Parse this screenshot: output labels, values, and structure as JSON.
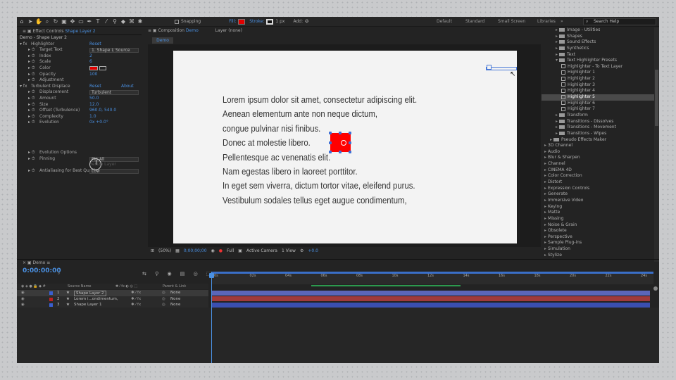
{
  "toolbar": {
    "snapping": "Snapping",
    "fill_label": "Fill:",
    "stroke_label": "Stroke:",
    "stroke_size": "1 px",
    "add_label": "Add:",
    "workspaces": [
      "Default",
      "Standard",
      "Small Screen",
      "Libraries"
    ],
    "search_help": "Search Help",
    "accent": "#4a90e2"
  },
  "effect_controls": {
    "tab_label": "Effect Controls",
    "tab_layer": "Shape Layer 2",
    "subtitle": "Demo - Shape Layer 2",
    "rows": [
      {
        "label": "Highlighter",
        "value": "Reset",
        "indent": 0,
        "type": "fx"
      },
      {
        "label": "Target Text",
        "value": "1. Shape L",
        "value2": "Source",
        "indent": 1,
        "type": "select2"
      },
      {
        "label": "Index",
        "value": "2",
        "indent": 1,
        "type": "num"
      },
      {
        "label": "Scale",
        "value": "6",
        "indent": 1,
        "type": "num"
      },
      {
        "label": "Color",
        "value": "",
        "indent": 1,
        "type": "color"
      },
      {
        "label": "Opacity",
        "value": "100",
        "indent": 1,
        "type": "num"
      },
      {
        "label": "Adjustment",
        "value": "",
        "indent": 1,
        "type": "plain"
      },
      {
        "label": "Turbulent Displace",
        "value": "Reset",
        "value2": "About",
        "indent": 0,
        "type": "fx2"
      },
      {
        "label": "Displacement",
        "value": "Turbulent",
        "indent": 1,
        "type": "select"
      },
      {
        "label": "Amount",
        "value": "50.0",
        "indent": 1,
        "type": "num"
      },
      {
        "label": "Size",
        "value": "12.0",
        "indent": 1,
        "type": "num"
      },
      {
        "label": "Offset (Turbulence)",
        "value": "960.0, 540.0",
        "indent": 1,
        "type": "num"
      },
      {
        "label": "Complexity",
        "value": "1.0",
        "indent": 1,
        "type": "num"
      },
      {
        "label": "Evolution",
        "value": "0x +0.0°",
        "indent": 1,
        "type": "num"
      },
      {
        "label": "",
        "value": "",
        "indent": 1,
        "type": "spacer"
      },
      {
        "label": "",
        "value": "",
        "indent": 1,
        "type": "spacer"
      },
      {
        "label": "",
        "value": "",
        "indent": 1,
        "type": "spacer"
      },
      {
        "label": "",
        "value": "",
        "indent": 1,
        "type": "spacer"
      },
      {
        "label": "Evolution Options",
        "value": "",
        "indent": 1,
        "type": "plain"
      },
      {
        "label": "Pinning",
        "value": "Pin All",
        "indent": 1,
        "type": "select"
      },
      {
        "label": "",
        "value": "Resize Layer",
        "indent": 1,
        "type": "dim"
      },
      {
        "label": "Antialiasing for Best Quality",
        "value": "Low",
        "indent": 1,
        "type": "select"
      }
    ]
  },
  "composition": {
    "tab_label": "Composition",
    "comp_name": "Demo",
    "layer_label": "Layer (none)",
    "sub_tab": "Demo",
    "text_lines": [
      "Lorem ipsum dolor sit amet, consectetur adipiscing elit.",
      "Aenean elementum ante non neque dictum,",
      "congue pulvinar nisi finibus.",
      "Donec at molestie libero.",
      "Pellentesque ac venenatis elit.",
      "Nam egestas libero in laoreet porttitor.",
      "In eget sem viverra, dictum tortor vitae, eleifend purus.",
      "Vestibulum sodales tellus eget augue condimentum,"
    ],
    "shape_color": "#ff0000"
  },
  "viewer_footer": {
    "zoom": "(50%)",
    "timecode": "0;00;00;00",
    "resolution": "Full",
    "camera": "Active Camera",
    "view": "1 View",
    "exposure": "+0.0"
  },
  "presets": {
    "items": [
      {
        "label": "Image - Utilities",
        "depth": 2,
        "kind": "folder"
      },
      {
        "label": "Shapes",
        "depth": 2,
        "kind": "folder"
      },
      {
        "label": "Sound Effects",
        "depth": 2,
        "kind": "folder"
      },
      {
        "label": "Synthetics",
        "depth": 2,
        "kind": "folder"
      },
      {
        "label": "Text",
        "depth": 2,
        "kind": "folder"
      },
      {
        "label": "Text Highlighter Presets",
        "depth": 2,
        "kind": "folder-open"
      },
      {
        "label": "Highlighter - To Text Layer",
        "depth": 3,
        "kind": "preset"
      },
      {
        "label": "Highlighter 1",
        "depth": 3,
        "kind": "preset"
      },
      {
        "label": "Highlighter 2",
        "depth": 3,
        "kind": "preset"
      },
      {
        "label": "Highlighter 3",
        "depth": 3,
        "kind": "preset"
      },
      {
        "label": "Highlighter 4",
        "depth": 3,
        "kind": "preset"
      },
      {
        "label": "Highlighter 5",
        "depth": 3,
        "kind": "preset",
        "selected": true
      },
      {
        "label": "Highlighter 6",
        "depth": 3,
        "kind": "preset"
      },
      {
        "label": "Highlighter 7",
        "depth": 3,
        "kind": "preset"
      },
      {
        "label": "Transform",
        "depth": 2,
        "kind": "folder"
      },
      {
        "label": "Transitions - Dissolves",
        "depth": 2,
        "kind": "folder"
      },
      {
        "label": "Transitions - Movement",
        "depth": 2,
        "kind": "folder"
      },
      {
        "label": "Transitions - Wipes",
        "depth": 2,
        "kind": "folder"
      },
      {
        "label": "Pseudo Effects Maker",
        "depth": 1,
        "kind": "folder"
      },
      {
        "label": "3D Channel",
        "depth": 0,
        "kind": "category"
      },
      {
        "label": "Audio",
        "depth": 0,
        "kind": "category"
      },
      {
        "label": "Blur & Sharpen",
        "depth": 0,
        "kind": "category"
      },
      {
        "label": "Channel",
        "depth": 0,
        "kind": "category"
      },
      {
        "label": "CINEMA 4D",
        "depth": 0,
        "kind": "category"
      },
      {
        "label": "Color Correction",
        "depth": 0,
        "kind": "category"
      },
      {
        "label": "Distort",
        "depth": 0,
        "kind": "category"
      },
      {
        "label": "Expression Controls",
        "depth": 0,
        "kind": "category"
      },
      {
        "label": "Generate",
        "depth": 0,
        "kind": "category"
      },
      {
        "label": "Immersive Video",
        "depth": 0,
        "kind": "category"
      },
      {
        "label": "Keying",
        "depth": 0,
        "kind": "category"
      },
      {
        "label": "Matte",
        "depth": 0,
        "kind": "category"
      },
      {
        "label": "Missing",
        "depth": 0,
        "kind": "category"
      },
      {
        "label": "Noise & Grain",
        "depth": 0,
        "kind": "category"
      },
      {
        "label": "Obsolete",
        "depth": 0,
        "kind": "category"
      },
      {
        "label": "Perspective",
        "depth": 0,
        "kind": "category"
      },
      {
        "label": "Sample Plug-ins",
        "depth": 0,
        "kind": "category"
      },
      {
        "label": "Simulation",
        "depth": 0,
        "kind": "category"
      },
      {
        "label": "Stylize",
        "depth": 0,
        "kind": "category"
      }
    ]
  },
  "timeline": {
    "tab_label": "Demo",
    "timecode": "0:00:00:00",
    "search_placeholder": "",
    "col_source": "Source Name",
    "col_parent": "Parent & Link",
    "ticks": [
      "0s",
      "02s",
      "04s",
      "06s",
      "08s",
      "10s",
      "12s",
      "14s",
      "16s",
      "18s",
      "20s",
      "22s",
      "24s"
    ],
    "layers": [
      {
        "num": "1",
        "name": "Shape Layer 2",
        "parent": "None",
        "label_color": "#3a5fd0",
        "bar_color": "#5b66b8",
        "selected": true
      },
      {
        "num": "2",
        "name": "Lorem i...ondimentum,",
        "parent": "None",
        "label_color": "#c02020",
        "bar_color": "#a03a3a"
      },
      {
        "num": "3",
        "name": "Shape Layer 1",
        "parent": "None",
        "label_color": "#3a5fd0",
        "bar_color": "#3a4fb0"
      }
    ]
  }
}
